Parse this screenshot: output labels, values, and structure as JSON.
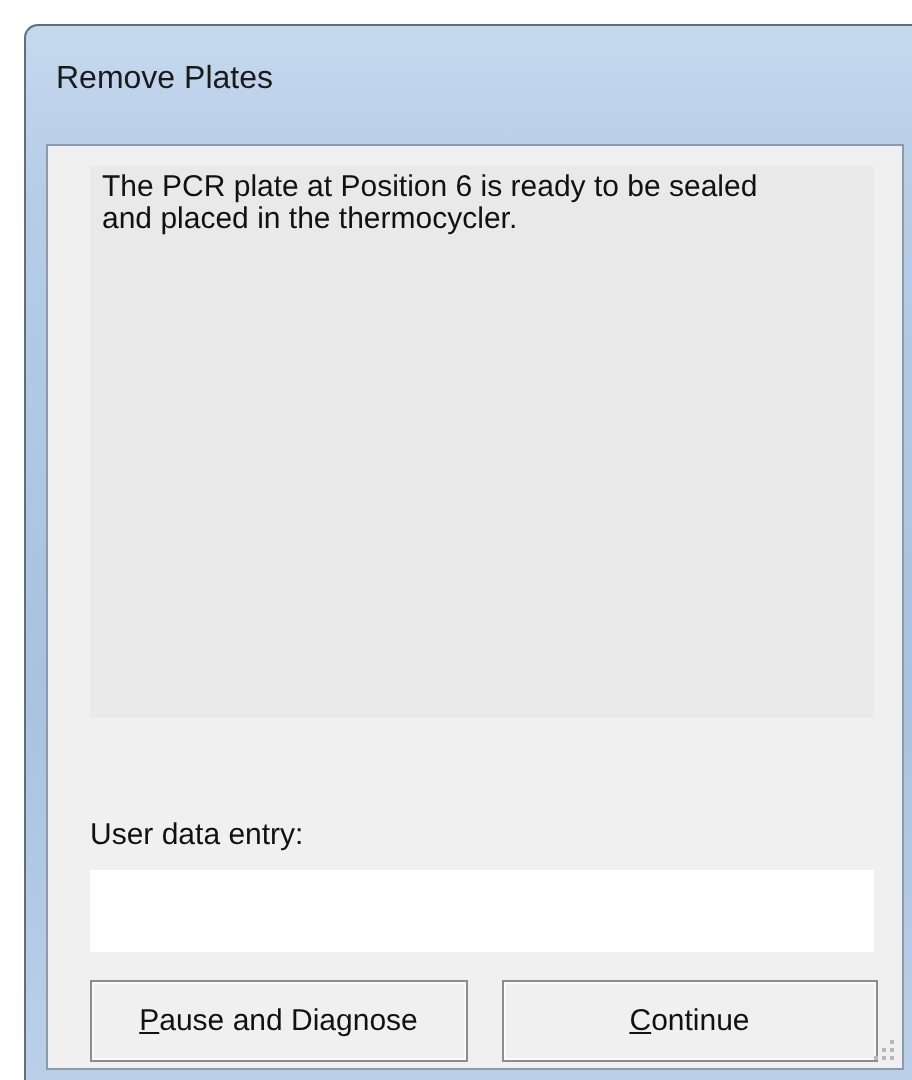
{
  "window": {
    "title": "Remove Plates"
  },
  "message": "The PCR plate at Position 6 is ready to be sealed and placed in the thermocycler.",
  "entry": {
    "label": "User data entry:"
  },
  "buttons": [
    {
      "label": "Pause and Diagnose"
    },
    {
      "label": "Continue"
    }
  ]
}
